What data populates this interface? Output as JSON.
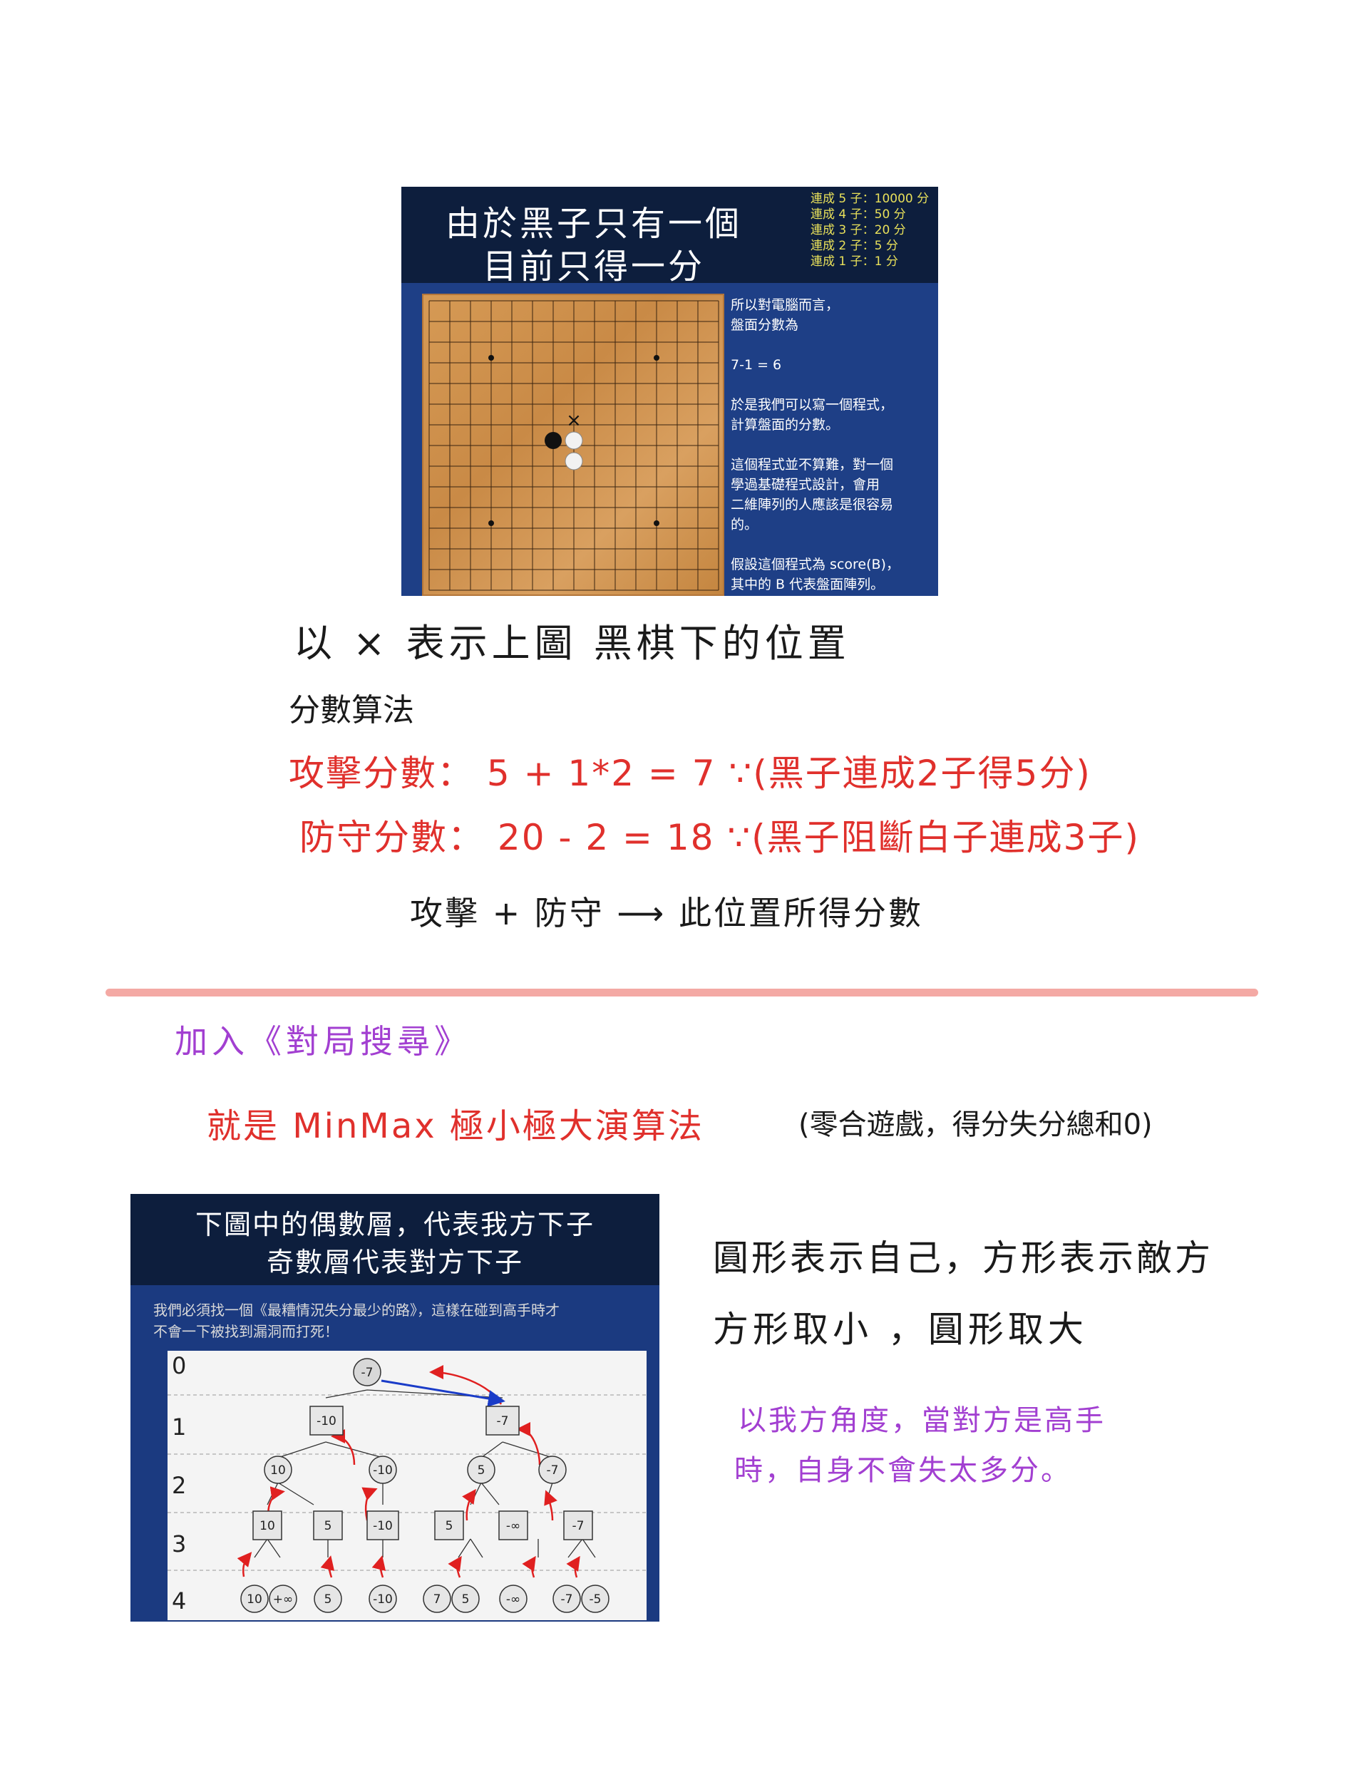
{
  "slide1": {
    "title_line1": "由於黑子只有一個",
    "title_line2": "目前只得一分",
    "score_table": [
      "連成 5 子：10000 分",
      "連成 4 子：50 分",
      "連成 3 子：20 分",
      "連成 2 子：5 分",
      "連成 1 子：1 分"
    ],
    "side_text": [
      "所以對電腦而言，",
      "盤面分數為",
      "",
      "7-1 = 6",
      "",
      "於是我們可以寫一個程式，",
      "計算盤面的分數。",
      "",
      "這個程式並不算難，對一個",
      "學過基礎程式設計，會用",
      "二維陣列的人應該是很容易",
      "的。",
      "",
      "假設這個程式為 score(B)，",
      "其中的 B 代表盤面陣列。"
    ],
    "board_mark": "×"
  },
  "notes": {
    "line1": "以 × 表示上圖 黑棋下的位置",
    "line2": "分數算法",
    "line3": "攻擊分數：  5 + 1*2 = 7 ∵(黑子連成2子得5分)",
    "line4": "防守分數：  20 - 2 = 18  ∵(黑子阻斷白子連成3子)",
    "line5": "攻擊 + 防守 ⟶ 此位置所得分數",
    "line6": "加入《對局搜尋》",
    "line7_red": "就是 MinMax 極小極大演算法",
    "line7_black": "(零合遊戲，得分失分總和0)",
    "right1": "圓形表示自己，方形表示敵方",
    "right2": "方形取小 ，圓形取大",
    "purple1": "以我方角度，當對方是高手",
    "purple2": "時，自身不會失太多分。"
  },
  "slide2": {
    "title_line1": "下圖中的偶數層，代表我方下子",
    "title_line2": "奇數層代表對方下子",
    "sub_line1": "我們必須找一個《最糟情況失分最少的路》，這樣在碰到高手時才",
    "sub_line2": "不會一下被找到漏洞而打死！",
    "levels": [
      "0",
      "1",
      "2",
      "3",
      "4"
    ],
    "nodes": {
      "n0": "-7",
      "n1a": "-10",
      "n1b": "-7",
      "n2a": "10",
      "n2b": "-10",
      "n2c": "5",
      "n2d": "-7",
      "n3a": "10",
      "n3b": "5",
      "n3c": "-10",
      "n3d": "5",
      "n3e": "-∞",
      "n3f": "-7",
      "n4a": "10",
      "n4b": "+∞",
      "n4c": "5",
      "n4d": "-10",
      "n4e": "7",
      "n4f": "5",
      "n4g": "-∞",
      "n4h": "-7",
      "n4i": "-5"
    }
  },
  "colors": {
    "divider": "#f4a9a4",
    "red_ink": "#e0302c",
    "purple_ink": "#a23fd1"
  }
}
